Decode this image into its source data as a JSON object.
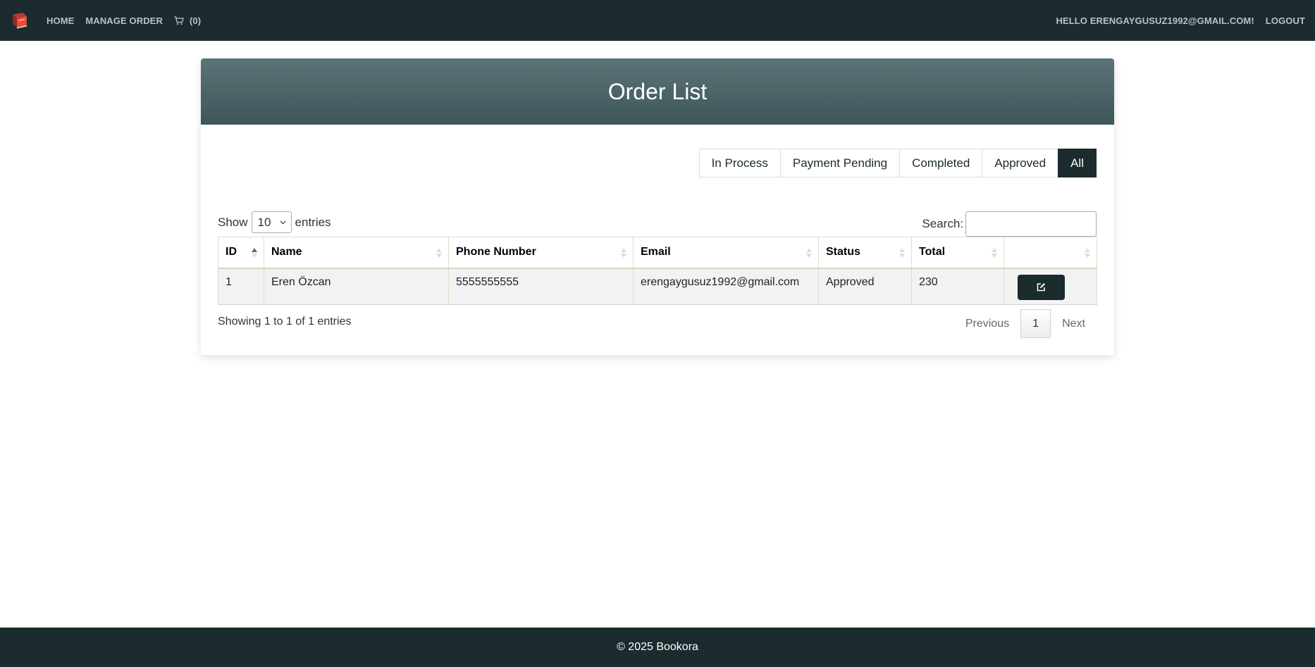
{
  "nav": {
    "home": "HOME",
    "manage_order": "MANAGE ORDER",
    "cart": "(0)",
    "greeting": "HELLO ERENGAYGUSUZ1992@GMAIL.COM!",
    "logout": "LOGOUT"
  },
  "card": {
    "title": "Order List"
  },
  "filters": [
    {
      "label": "In Process",
      "active": false
    },
    {
      "label": "Payment Pending",
      "active": false
    },
    {
      "label": "Completed",
      "active": false
    },
    {
      "label": "Approved",
      "active": false
    },
    {
      "label": "All",
      "active": true
    }
  ],
  "table_controls": {
    "show": "Show",
    "page_size": "10",
    "entries": "entries",
    "search_label": "Search:"
  },
  "table": {
    "columns": [
      "ID",
      "Name",
      "Phone Number",
      "Email",
      "Status",
      "Total",
      ""
    ],
    "rows": [
      {
        "id": "1",
        "name": "Eren Özcan",
        "phone": "5555555555",
        "email": "erengaygusuz1992@gmail.com",
        "status": "Approved",
        "total": "230"
      }
    ]
  },
  "pagination": {
    "info": "Showing 1 to 1 of 1 entries",
    "previous": "Previous",
    "current": "1",
    "next": "Next"
  },
  "footer": {
    "text": "© 2025 Bookora"
  },
  "colors": {
    "navbar": "#1b2b2e",
    "header_gradient_top": "#5b7477",
    "header_gradient_bottom": "#3e5659"
  }
}
